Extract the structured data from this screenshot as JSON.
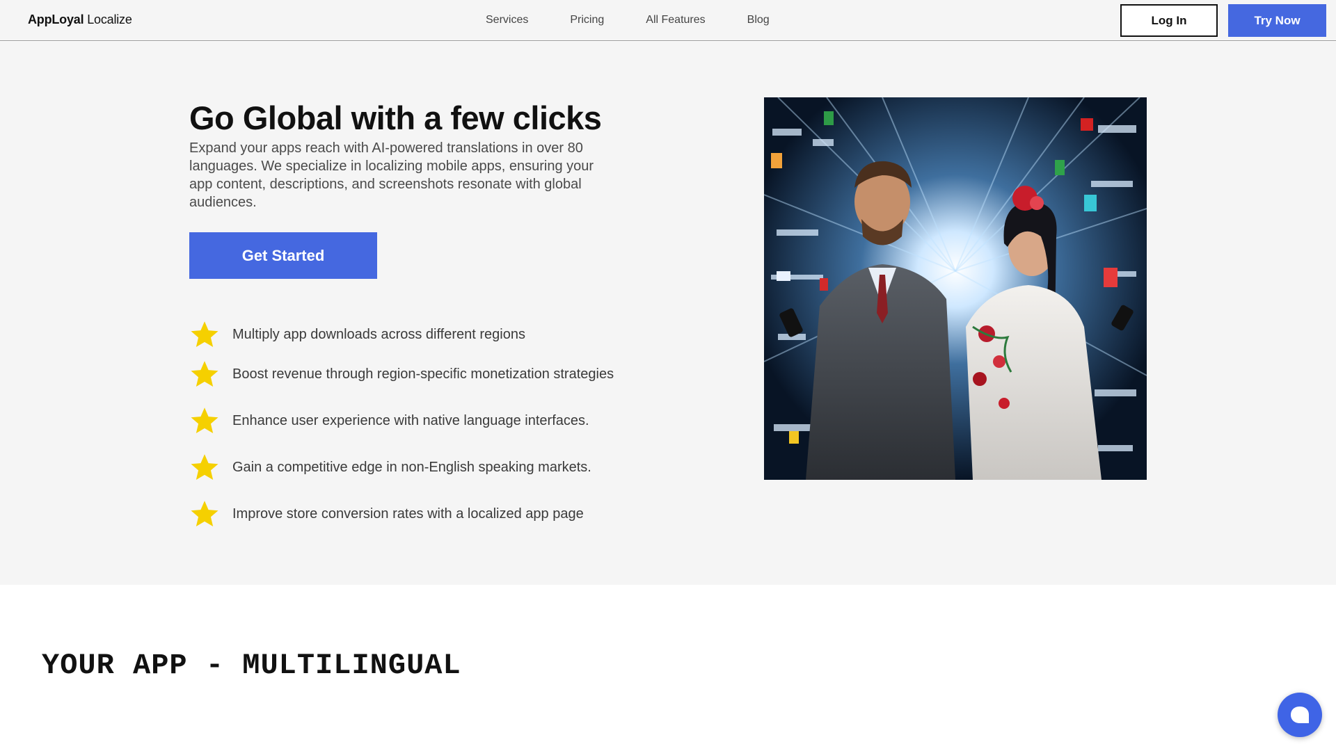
{
  "header": {
    "logo_bold": "AppLoyal",
    "logo_light": "Localize",
    "nav": [
      "Services",
      "Pricing",
      "All Features",
      "Blog"
    ],
    "login_label": "Log In",
    "try_label": "Try Now"
  },
  "hero": {
    "title": "Go Global with a few clicks",
    "description": "Expand your apps reach with AI-powered translations in over 80 languages. We specialize in localizing mobile apps, ensuring your app content, descriptions, and screenshots resonate with global audiences.",
    "cta_label": "Get Started",
    "benefits": [
      "Multiply app downloads across different regions",
      "Boost revenue through region-specific monetization strategies",
      "Enhance user experience with native language interfaces.",
      "Gain a competitive edge in non-English speaking markets.",
      "Improve store conversion rates with a localized app page"
    ],
    "image_alt": "Two people using phones surrounded by multilingual text"
  },
  "section": {
    "title": "YOUR APP - MULTILINGUAL"
  },
  "colors": {
    "accent": "#4568e0",
    "star": "#f5d000",
    "hero_bg": "#f5f5f5"
  },
  "icons": {
    "benefit": "star-icon",
    "chat": "chat-bubble-icon"
  }
}
